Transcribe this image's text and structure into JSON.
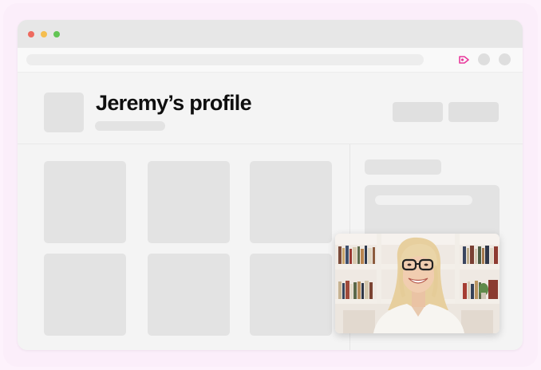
{
  "profile": {
    "title": "Jeremy’s profile"
  },
  "window_controls": [
    "close",
    "minimize",
    "maximize"
  ],
  "toolbar": {
    "extension_icon": "screen-recorder-icon"
  },
  "colors": {
    "background": "#fdf2fc",
    "accent": "#e8399c",
    "dot_red": "#ee6a5f",
    "dot_yellow": "#f5be4f",
    "dot_green": "#62c554"
  },
  "video_call": {
    "icon": "webcam-video-feed"
  }
}
